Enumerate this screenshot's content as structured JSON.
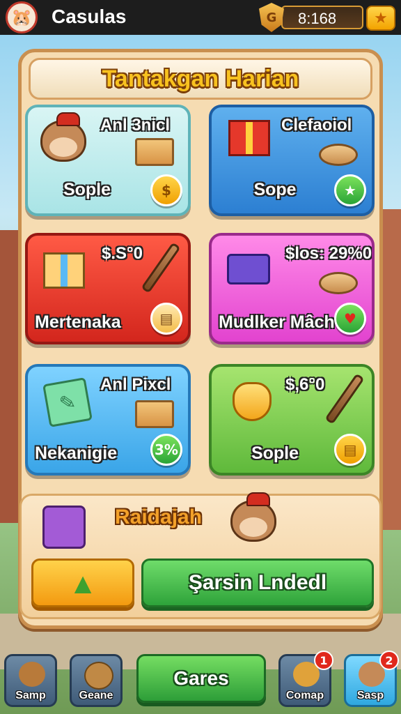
{
  "app": {
    "title": "Casulas"
  },
  "currency": {
    "value": "8:168",
    "shield_letter": "G"
  },
  "panel": {
    "title": "Tantakgan Harian"
  },
  "cards": [
    {
      "title": "Anl 3nicl",
      "label": "Sople",
      "badge": "$"
    },
    {
      "title": "Clefaoiol",
      "label": "Sope",
      "badge": "★"
    },
    {
      "title": "$.S°0",
      "label": "Mertenaka",
      "badge": "▤"
    },
    {
      "title": "$los: 29%0",
      "label": "Mudlker Mâch",
      "badge": "♥"
    },
    {
      "title": "Anl Pixcl",
      "label": "Nekanigie",
      "badge": "3%"
    },
    {
      "title": "$,6°0",
      "label": "Sople",
      "badge": "▤"
    }
  ],
  "reward": {
    "title": "Raidajah",
    "claim_label": "Şarsin Lndedl"
  },
  "nav": {
    "items": [
      {
        "label": "Samp"
      },
      {
        "label": "Geane"
      },
      {
        "label": "Gares"
      },
      {
        "label": "Comap",
        "badge": "1"
      },
      {
        "label": "Sasp",
        "badge": "2"
      }
    ]
  },
  "colors": {
    "accent_gold": "#f8c21f",
    "panel_bg": "#f6dcb2",
    "green_button": "#2ea33a"
  }
}
